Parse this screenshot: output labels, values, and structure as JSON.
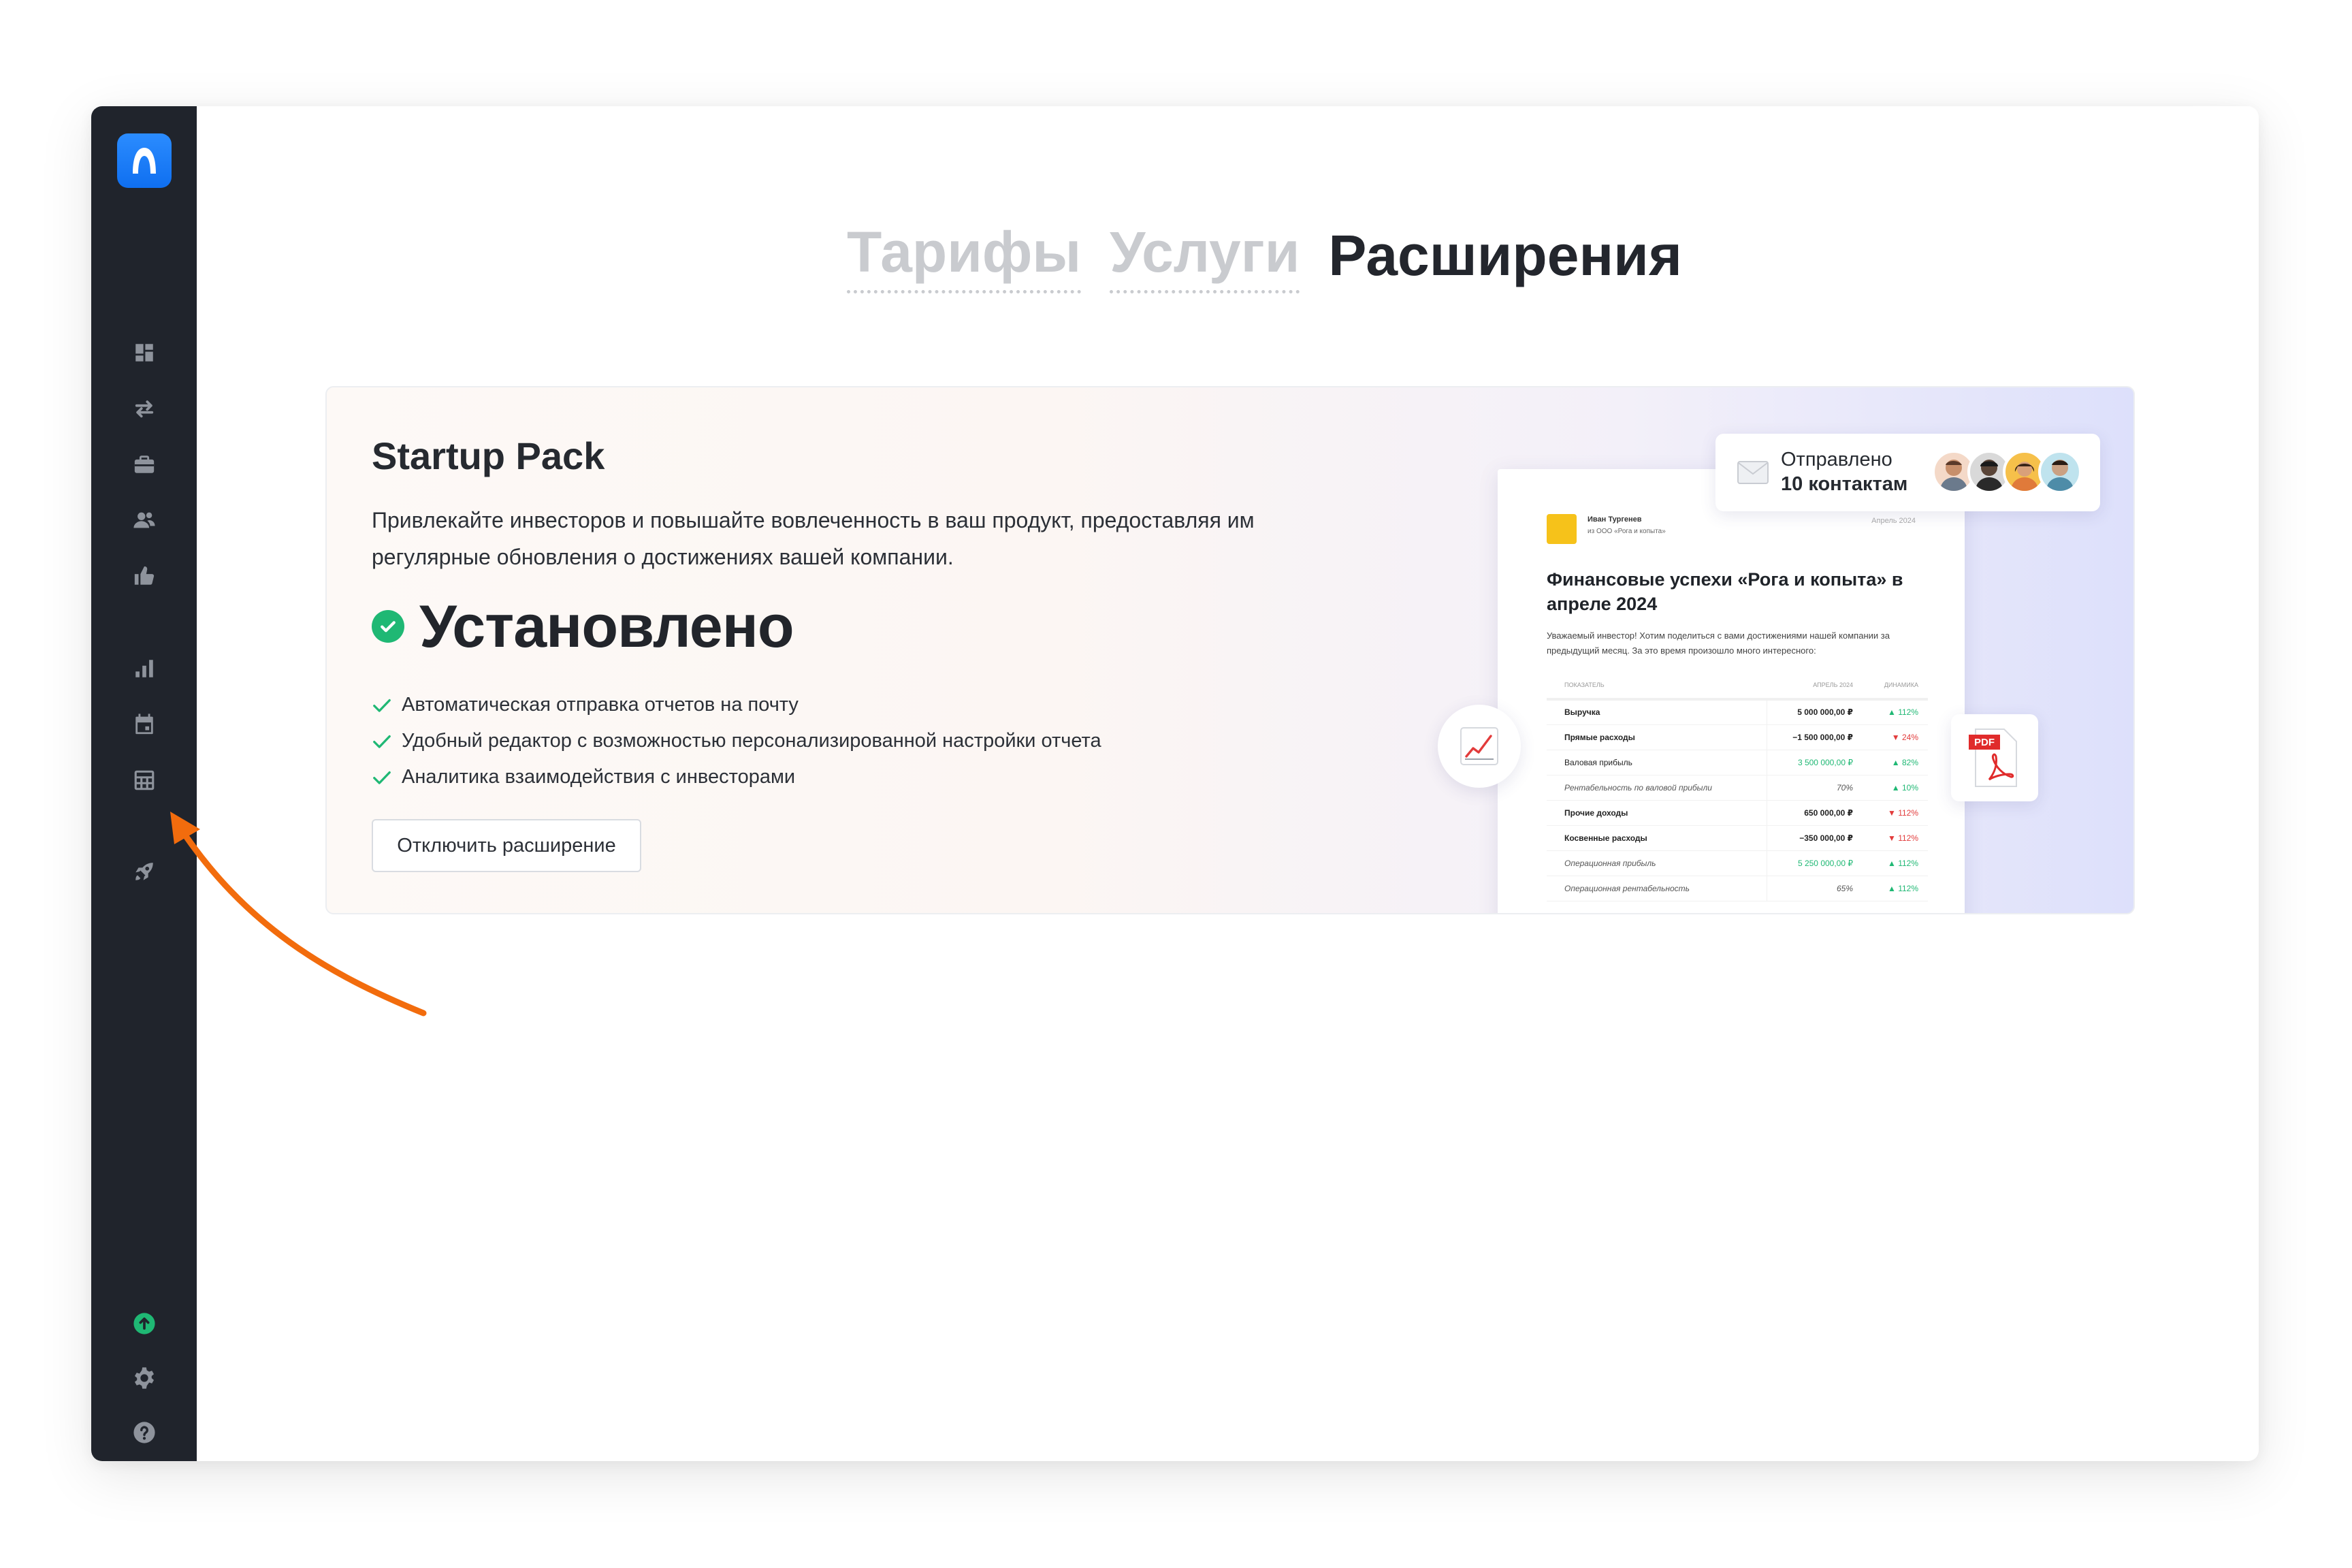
{
  "sidebar": {
    "logo_icon": "app-logo-icon",
    "items": [
      {
        "icon": "dashboard-icon"
      },
      {
        "icon": "transfers-icon"
      },
      {
        "icon": "briefcase-icon"
      },
      {
        "icon": "users-icon"
      },
      {
        "icon": "thumbs-up-icon"
      },
      {
        "icon": "bar-chart-icon"
      },
      {
        "icon": "calendar-icon"
      },
      {
        "icon": "table-icon"
      },
      {
        "icon": "rocket-icon"
      }
    ],
    "bottom": [
      {
        "icon": "upload-circle-icon",
        "color": "#1fb874"
      },
      {
        "icon": "gear-icon"
      },
      {
        "icon": "help-icon"
      }
    ],
    "colors": {
      "bg": "#20242c",
      "icon": "#8e939c",
      "logo": "#1a7ef6"
    }
  },
  "tabs": [
    {
      "label": "Тарифы",
      "active": false
    },
    {
      "label": "Услуги",
      "active": false
    },
    {
      "label": "Расширения",
      "active": true
    }
  ],
  "card": {
    "title": "Startup Pack",
    "description": "Привлекайте инвесторов и повышайте вовлеченность в ваш продукт, предоставляя им регулярные обновления о достижениях вашей компании.",
    "status": "Установлено",
    "features": [
      "Автоматическая отправка отчетов на почту",
      "Удобный редактор с возможностью персонализированной настройки отчета",
      "Аналитика взаимодействия с инвесторами"
    ],
    "button_label": "Отключить расширение",
    "accent_color": "#1fb874"
  },
  "illustration": {
    "sent": {
      "line1": "Отправлено",
      "line2": "10 контактам",
      "icon": "envelope-icon"
    },
    "report": {
      "author": "Иван Тургенев",
      "company": "из ООО «Рога и копыта»",
      "date": "Апрель 2024",
      "title": "Финансовые успехи «Рога и копыта» в апреле 2024",
      "intro": "Уважаемый инвестор! Хотим поделиться с вами достижениями нашей компании за предыдущий месяц. За это время произошло много интересного:",
      "headers": [
        "ПОКАЗАТЕЛЬ",
        "АПРЕЛЬ 2024",
        "ДИНАМИКА"
      ],
      "rows": [
        {
          "name": "Выручка",
          "value": "5 000 000,00 ₽",
          "dyn": "▲ 112%",
          "style": "bold",
          "dir": "up"
        },
        {
          "name": "Прямые расходы",
          "value": "−1 500 000,00 ₽",
          "dyn": "▼ 24%",
          "style": "bold",
          "dir": "down"
        },
        {
          "name": "Валовая прибыль",
          "value": "3 500 000,00 ₽",
          "dyn": "▲ 82%",
          "style": "sub",
          "dir": "up"
        },
        {
          "name": "Рентабельность по валовой прибыли",
          "value": "70%",
          "dyn": "▲ 10%",
          "style": "italic",
          "dir": "up"
        },
        {
          "name": "Прочие доходы",
          "value": "650 000,00 ₽",
          "dyn": "▼ 112%",
          "style": "bold",
          "dir": "down"
        },
        {
          "name": "Косвенные расходы",
          "value": "−350 000,00 ₽",
          "dyn": "▼ 112%",
          "style": "bold",
          "dir": "down"
        },
        {
          "name": "Операционная прибыль",
          "value": "5 250 000,00 ₽",
          "dyn": "▲ 112%",
          "style": "italic",
          "dir": "up"
        },
        {
          "name": "Операционная рентабельность",
          "value": "65%",
          "dyn": "▲ 112%",
          "style": "italic",
          "dir": "up"
        }
      ]
    },
    "chart_icon": "trend-chart-icon",
    "pdf_icon": "pdf-file-icon",
    "pdf_label": "PDF"
  },
  "annotation": {
    "icon": "arrow-annotation-icon",
    "color": "#f26c0d"
  }
}
